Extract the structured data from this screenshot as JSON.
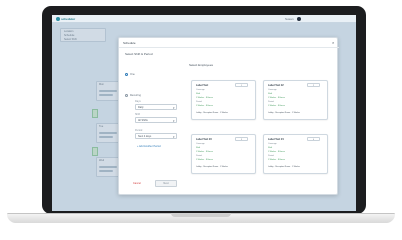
{
  "app": {
    "logo_text": "scheduler",
    "user_name": "Susan"
  },
  "background": {
    "info_card": [
      "Location",
      "Schedule",
      "Select Shift"
    ],
    "left_labels": [
      "Mon",
      "Tue",
      "Wed"
    ]
  },
  "modal": {
    "title": "Schedule",
    "close_glyph": "×",
    "left_panel": {
      "heading": "Select Shift & Period",
      "options": [
        "One",
        "Recurring"
      ],
      "fields": [
        {
          "label": "Days",
          "value": "Daily"
        },
        {
          "label": "Shift",
          "value": "All Shifts"
        },
        {
          "label": "Period",
          "value": "Next 4 days"
        }
      ],
      "add_link": "+ Add Another Period",
      "cancel_label": "Cancel",
      "next_label": "Next"
    },
    "right_panel": {
      "heading": "Select Employees",
      "cards": [
        {
          "title": "Label Text",
          "badge": "1",
          "lines": [
            "Coverage",
            "Shift",
            "1 Worker · 8 Hours",
            "Period",
            "1 Worker · 8 Hours",
            "Lobby · Reception Room · 1 Worker"
          ]
        },
        {
          "title": "Label Text #2",
          "badge": "2",
          "lines": [
            "Coverage",
            "Shift",
            "1 Worker · 8 Hours",
            "Period",
            "1 Worker · 8 Hours",
            "Lobby · Reception Room · 1 Worker"
          ]
        },
        {
          "title": "Label Text #3",
          "badge": "3",
          "lines": [
            "Coverage",
            "Shift",
            "1 Worker · 8 Hours",
            "Period",
            "1 Worker · 8 Hours",
            "Lobby · Reception Room · 1 Worker"
          ]
        },
        {
          "title": "Label Text #4",
          "badge": "4",
          "lines": [
            "Coverage",
            "Shift",
            "1 Worker · 8 Hours",
            "Period",
            "1 Worker · 8 Hours",
            "Lobby · Reception Room · 1 Worker"
          ]
        }
      ]
    }
  },
  "colors": {
    "accent": "#2e7bb8",
    "success": "#3f9a5a",
    "danger": "#d23b3b"
  }
}
